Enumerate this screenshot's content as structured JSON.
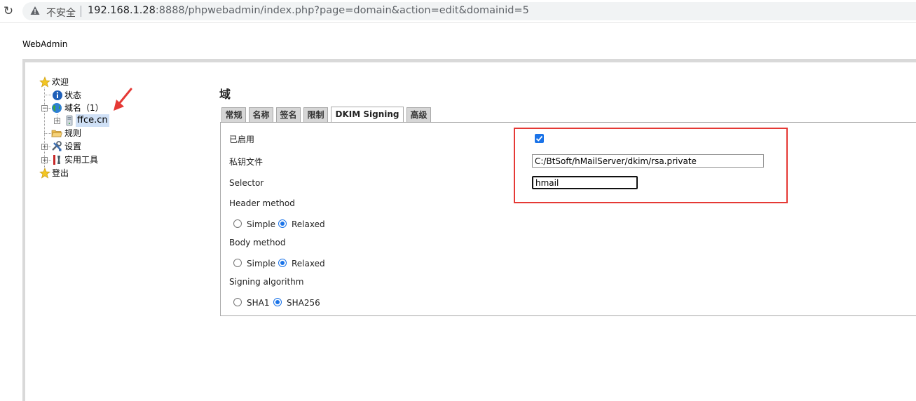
{
  "browser": {
    "security_label": "不安全",
    "url_host": "192.168.1.28",
    "url_rest": ":8888/phpwebadmin/index.php?page=domain&action=edit&domainid=5"
  },
  "site": {
    "title": "WebAdmin"
  },
  "tree": {
    "welcome": "欢迎",
    "status": "状态",
    "domains": "域名（1）",
    "domain_item": "ffce.cn",
    "rules": "规则",
    "settings": "设置",
    "utilities": "实用工具",
    "logout": "登出"
  },
  "page": {
    "title": "域",
    "tabs": [
      {
        "label": "常规"
      },
      {
        "label": "名称"
      },
      {
        "label": "签名"
      },
      {
        "label": "限制"
      },
      {
        "label": "DKIM Signing",
        "active": true
      },
      {
        "label": "高级"
      }
    ],
    "form": {
      "enabled_label": "已启用",
      "enabled_checked": true,
      "private_key_label": "私钥文件",
      "private_key_value": "C:/BtSoft/hMailServer/dkim/rsa.private",
      "selector_label": "Selector",
      "selector_value": "hmail",
      "header_method_label": "Header method",
      "header_method_options": [
        "Simple",
        "Relaxed"
      ],
      "header_method_selected": "Relaxed",
      "body_method_label": "Body method",
      "body_method_options": [
        "Simple",
        "Relaxed"
      ],
      "body_method_selected": "Relaxed",
      "signing_algorithm_label": "Signing algorithm",
      "signing_algorithm_options": [
        "SHA1",
        "SHA256"
      ],
      "signing_algorithm_selected": "SHA256"
    }
  },
  "colors": {
    "accent": "#1a73e8",
    "annotation": "#e53935",
    "tab_bg": "#d6d6d6"
  }
}
